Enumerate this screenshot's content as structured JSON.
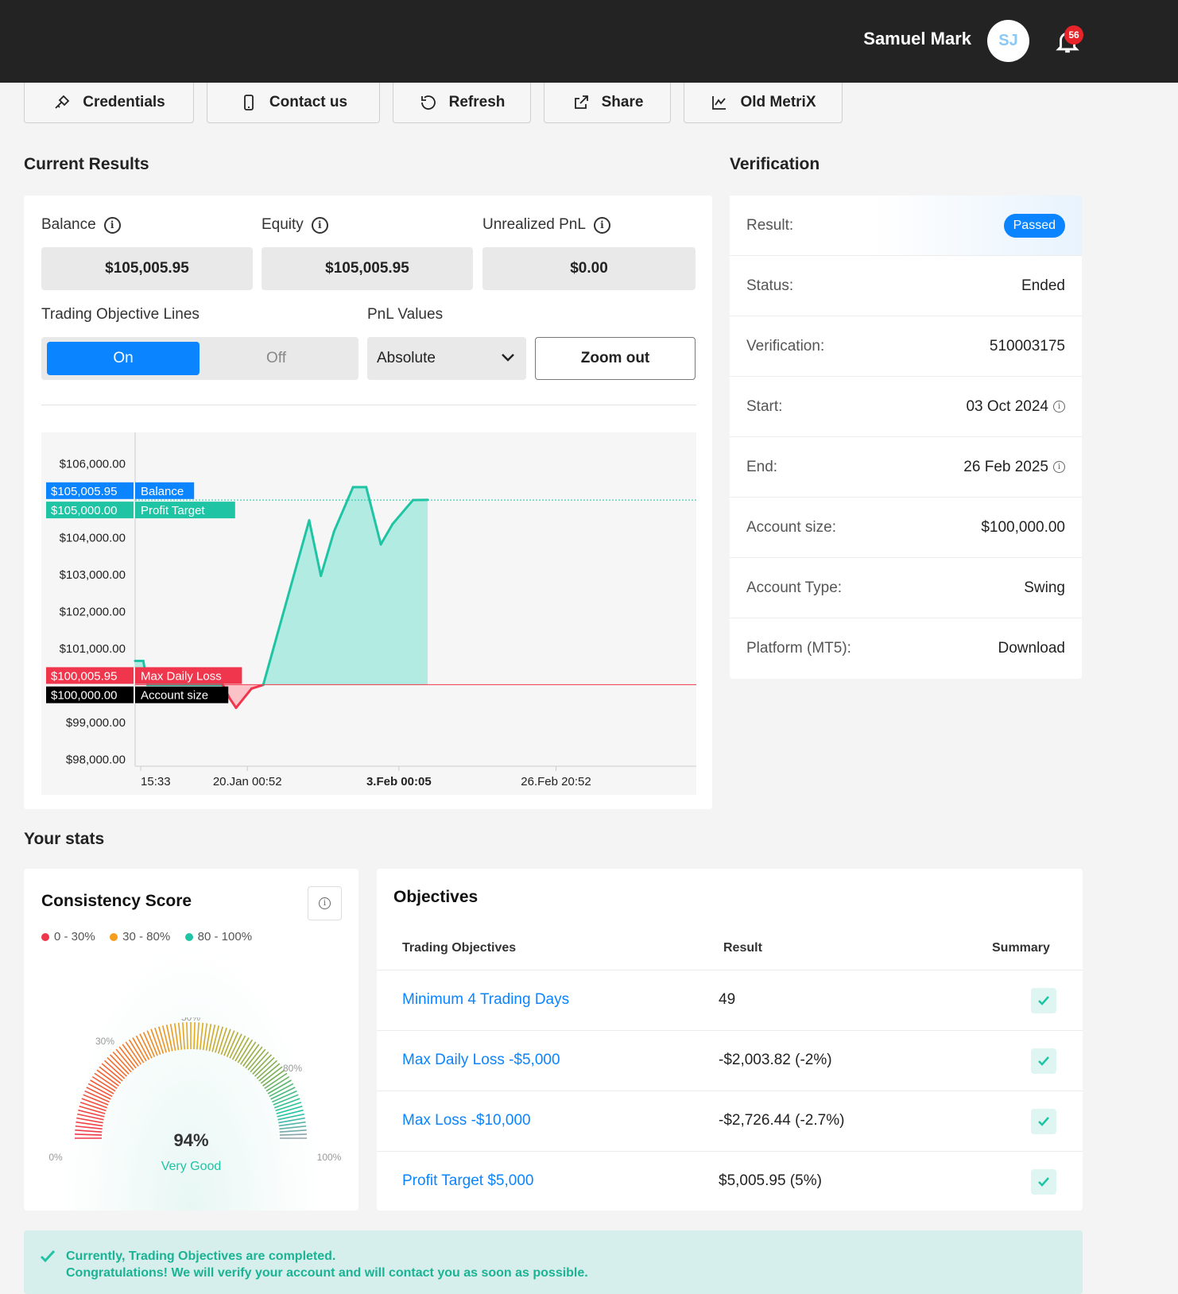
{
  "header": {
    "user_name": "Samuel Mark",
    "avatar_initials": "SJ",
    "notification_count": "56"
  },
  "toolbar": {
    "credentials": "Credentials",
    "contact": "Contact us",
    "refresh": "Refresh",
    "share": "Share",
    "old_metrix": "Old MetriX"
  },
  "current_results": {
    "title": "Current Results",
    "balance_label": "Balance",
    "balance_value": "$105,005.95",
    "equity_label": "Equity",
    "equity_value": "$105,005.95",
    "unrealized_label": "Unrealized PnL",
    "unrealized_value": "$0.00",
    "objective_lines_label": "Trading Objective Lines",
    "toggle_on": "On",
    "toggle_off": "Off",
    "pnl_values_label": "PnL Values",
    "pnl_select_value": "Absolute",
    "zoom_out": "Zoom out"
  },
  "chart_data": {
    "type": "area",
    "ylim": [
      97800,
      106400
    ],
    "y_ticks": [
      "$106,000.00",
      "$104,000.00",
      "$103,000.00",
      "$102,000.00",
      "$101,000.00",
      "$99,000.00",
      "$98,000.00"
    ],
    "y_tick_values": [
      106000,
      104000,
      103000,
      102000,
      101000,
      99000,
      98000
    ],
    "x_ticks": [
      "15:33",
      "20.Jan 00:52",
      "3.Feb 00:05",
      "26.Feb 20:52"
    ],
    "x_tick_bold": [
      false,
      false,
      true,
      false
    ],
    "x_tick_positions": [
      0.01,
      0.2,
      0.47,
      0.75
    ],
    "baseline": 100000,
    "series": [
      {
        "x": [
          0.0,
          0.028,
          0.042,
          0.16,
          0.3,
          0.322,
          0.345,
          0.398,
          0.438,
          0.475,
          0.595,
          0.635,
          0.68,
          0.745,
          0.79,
          0.84,
          0.88,
          0.95,
          1.0
        ],
        "values": [
          100650,
          100650,
          100000,
          100000,
          100000,
          99650,
          99380,
          99900,
          100000,
          101050,
          104450,
          102950,
          104150,
          105350,
          105350,
          103800,
          104350,
          105000,
          105005.95
        ]
      }
    ],
    "reference_lines": [
      {
        "label": "Balance",
        "value_label": "$105,005.95",
        "value": 105005.95,
        "color": "#0a84ff"
      },
      {
        "label": "Profit Target",
        "value_label": "$105,000.00",
        "value": 105000,
        "color": "#1fc4a4"
      },
      {
        "label": "Max Daily Loss",
        "value_label": "$100,005.95",
        "value": 100005.95,
        "color": "#f0364c"
      },
      {
        "label": "Account size",
        "value_label": "$100,000.00",
        "value": 100000,
        "color": "#000000"
      }
    ],
    "colors": {
      "positive_line": "#1fc4a4",
      "positive_fill": "#b2ebe1",
      "negative_line": "#f0364c",
      "negative_fill": "#fbc3c8"
    }
  },
  "verification": {
    "title": "Verification",
    "rows": [
      {
        "label": "Result:",
        "value": "Passed"
      },
      {
        "label": "Status:",
        "value": "Ended"
      },
      {
        "label": "Verification:",
        "value": "510003175"
      },
      {
        "label": "Start:",
        "value": "03 Oct 2024"
      },
      {
        "label": "End:",
        "value": "26 Feb 2025"
      },
      {
        "label": "Account size:",
        "value": "$100,000.00"
      },
      {
        "label": "Account Type:",
        "value": "Swing"
      },
      {
        "label": "Platform (MT5):",
        "value": "Download"
      }
    ]
  },
  "stats": {
    "title": "Your stats",
    "consistency": {
      "title": "Consistency Score",
      "legend": [
        "0 - 30%",
        "30 - 80%",
        "80 - 100%"
      ],
      "legend_colors": [
        "#f0364c",
        "#f59e1b",
        "#1fc4a4"
      ],
      "score": 94,
      "score_label": "94%",
      "rating": "Very Good",
      "gauge_labels": [
        "0%",
        "30%",
        "50%",
        "80%",
        "100%"
      ]
    },
    "objectives": {
      "title": "Objectives",
      "col_objective": "Trading Objectives",
      "col_result": "Result",
      "col_summary": "Summary",
      "rows": [
        {
          "name": "Minimum 4 Trading Days",
          "result": "49"
        },
        {
          "name": "Max Daily Loss -$5,000",
          "result": "-$2,003.82 (-2%)"
        },
        {
          "name": "Max Loss -$10,000",
          "result": "-$2,726.44 (-2.7%)"
        },
        {
          "name": "Profit Target $5,000",
          "result": "$5,005.95 (5%)"
        }
      ]
    }
  },
  "success_message": {
    "line1": "Currently, Trading Objectives are completed.",
    "line2": "Congratulations! We will verify your account and will contact you as soon as possible."
  }
}
